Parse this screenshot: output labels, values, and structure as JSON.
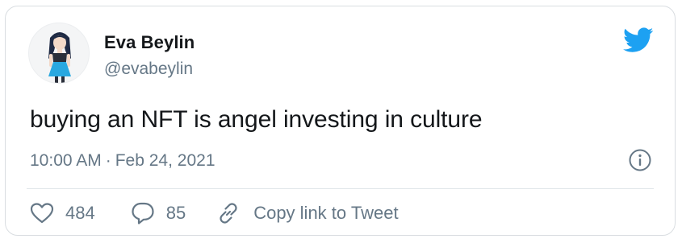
{
  "author": {
    "name": "Eva Beylin",
    "handle": "@evabeylin"
  },
  "tweet": {
    "text": "buying an NFT is angel investing in culture",
    "time": "10:00 AM",
    "separator": "·",
    "date": "Feb 24, 2021"
  },
  "actions": {
    "likes": "484",
    "replies": "85",
    "copy_link_label": "Copy link to Tweet"
  },
  "icons": {
    "brand": "twitter-bird-icon",
    "info": "info-icon",
    "like": "heart-icon",
    "reply": "speech-bubble-icon",
    "link": "link-icon"
  },
  "colors": {
    "brand_blue": "#1da1f2",
    "text_primary": "#14171a",
    "text_secondary": "#657786",
    "border": "#d9dde1"
  }
}
